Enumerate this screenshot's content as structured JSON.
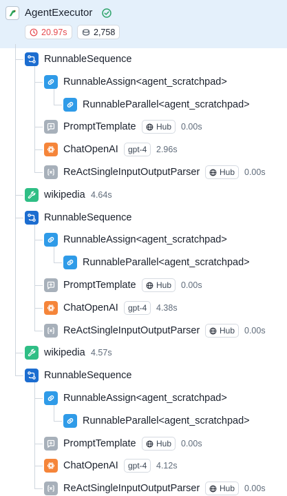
{
  "root": {
    "name": "AgentExecutor",
    "latency": "20.97s",
    "tokens": "2,758",
    "colors": {
      "header_bg": "#e4f0fb",
      "latency_red": "#e5484d",
      "success_green": "#30a46c"
    }
  },
  "runs": [
    {
      "name": "RunnableSequence",
      "kind": "sequence",
      "depth": 1
    },
    {
      "name": "RunnableAssign<agent_scratchpad>",
      "kind": "link",
      "depth": 2
    },
    {
      "name": "RunnableParallel<agent_scratchpad>",
      "kind": "link",
      "depth": 3
    },
    {
      "name": "PromptTemplate",
      "kind": "prompt",
      "depth": 2,
      "tag": "Hub",
      "latency": "0.00s"
    },
    {
      "name": "ChatOpenAI",
      "kind": "llm",
      "depth": 2,
      "tag": "gpt-4",
      "latency": "2.96s"
    },
    {
      "name": "ReActSingleInputOutputParser",
      "kind": "parser",
      "depth": 2,
      "tag": "Hub",
      "latency": "0.00s"
    },
    {
      "name": "wikipedia",
      "kind": "tool",
      "depth": 1,
      "latency": "4.64s"
    },
    {
      "name": "RunnableSequence",
      "kind": "sequence",
      "depth": 1
    },
    {
      "name": "RunnableAssign<agent_scratchpad>",
      "kind": "link",
      "depth": 2
    },
    {
      "name": "RunnableParallel<agent_scratchpad>",
      "kind": "link",
      "depth": 3
    },
    {
      "name": "PromptTemplate",
      "kind": "prompt",
      "depth": 2,
      "tag": "Hub",
      "latency": "0.00s"
    },
    {
      "name": "ChatOpenAI",
      "kind": "llm",
      "depth": 2,
      "tag": "gpt-4",
      "latency": "4.38s"
    },
    {
      "name": "ReActSingleInputOutputParser",
      "kind": "parser",
      "depth": 2,
      "tag": "Hub",
      "latency": "0.00s"
    },
    {
      "name": "wikipedia",
      "kind": "tool",
      "depth": 1,
      "latency": "4.57s"
    },
    {
      "name": "RunnableSequence",
      "kind": "sequence",
      "depth": 1
    },
    {
      "name": "RunnableAssign<agent_scratchpad>",
      "kind": "link",
      "depth": 2
    },
    {
      "name": "RunnableParallel<agent_scratchpad>",
      "kind": "link",
      "depth": 3
    },
    {
      "name": "PromptTemplate",
      "kind": "prompt",
      "depth": 2,
      "tag": "Hub",
      "latency": "0.00s"
    },
    {
      "name": "ChatOpenAI",
      "kind": "llm",
      "depth": 2,
      "tag": "gpt-4",
      "latency": "4.12s"
    },
    {
      "name": "ReActSingleInputOutputParser",
      "kind": "parser",
      "depth": 2,
      "tag": "Hub",
      "latency": "0.00s"
    }
  ],
  "icons": {
    "sequence": {
      "name": "sequence-icon",
      "color": "#1c6dd0"
    },
    "link": {
      "name": "link-icon",
      "color": "#2f9be8"
    },
    "prompt": {
      "name": "prompt-icon",
      "color": "#a7b0ba"
    },
    "llm": {
      "name": "openai-icon",
      "color": "#f5853a"
    },
    "parser": {
      "name": "parser-icon",
      "color": "#a7b0ba"
    },
    "tool": {
      "name": "wrench-icon",
      "color": "#2fbe85"
    }
  }
}
